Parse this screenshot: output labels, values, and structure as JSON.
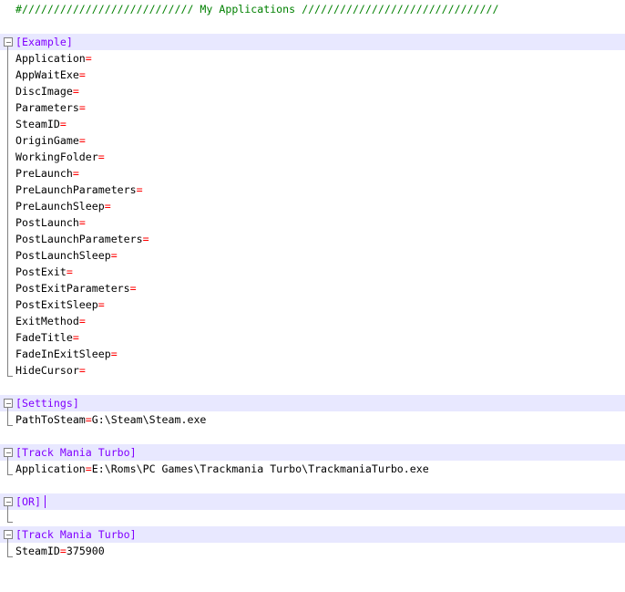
{
  "editor": {
    "comment": "#/////////////////////////// My Applications ///////////////////////////////",
    "sections": [
      {
        "header": "[Example]",
        "entries": [
          {
            "key": "Application",
            "value": ""
          },
          {
            "key": "AppWaitExe",
            "value": ""
          },
          {
            "key": "DiscImage",
            "value": ""
          },
          {
            "key": "Parameters",
            "value": ""
          },
          {
            "key": "SteamID",
            "value": ""
          },
          {
            "key": "OriginGame",
            "value": ""
          },
          {
            "key": "WorkingFolder",
            "value": ""
          },
          {
            "key": "PreLaunch",
            "value": ""
          },
          {
            "key": "PreLaunchParameters",
            "value": ""
          },
          {
            "key": "PreLaunchSleep",
            "value": ""
          },
          {
            "key": "PostLaunch",
            "value": ""
          },
          {
            "key": "PostLaunchParameters",
            "value": ""
          },
          {
            "key": "PostLaunchSleep",
            "value": ""
          },
          {
            "key": "PostExit",
            "value": ""
          },
          {
            "key": "PostExitParameters",
            "value": ""
          },
          {
            "key": "PostExitSleep",
            "value": ""
          },
          {
            "key": "ExitMethod",
            "value": ""
          },
          {
            "key": "FadeTitle",
            "value": ""
          },
          {
            "key": "FadeInExitSleep",
            "value": ""
          },
          {
            "key": "HideCursor",
            "value": ""
          }
        ]
      },
      {
        "header": "[Settings]",
        "entries": [
          {
            "key": "PathToSteam",
            "value": "G:\\Steam\\Steam.exe"
          }
        ]
      },
      {
        "header": "[Track Mania Turbo]",
        "entries": [
          {
            "key": "Application",
            "value": "E:\\Roms\\PC Games\\Trackmania Turbo\\TrackmaniaTurbo.exe"
          }
        ]
      },
      {
        "header": "[OR]",
        "current": true,
        "entries": []
      },
      {
        "header": "[Track Mania Turbo]",
        "entries": [
          {
            "key": "SteamID",
            "value": "375900"
          }
        ]
      }
    ],
    "colors": {
      "comment": "#008000",
      "section": "#8000ff",
      "equals": "#ff0000",
      "section_highlight": "#e8e8ff",
      "fold_marker": "#808080"
    }
  }
}
